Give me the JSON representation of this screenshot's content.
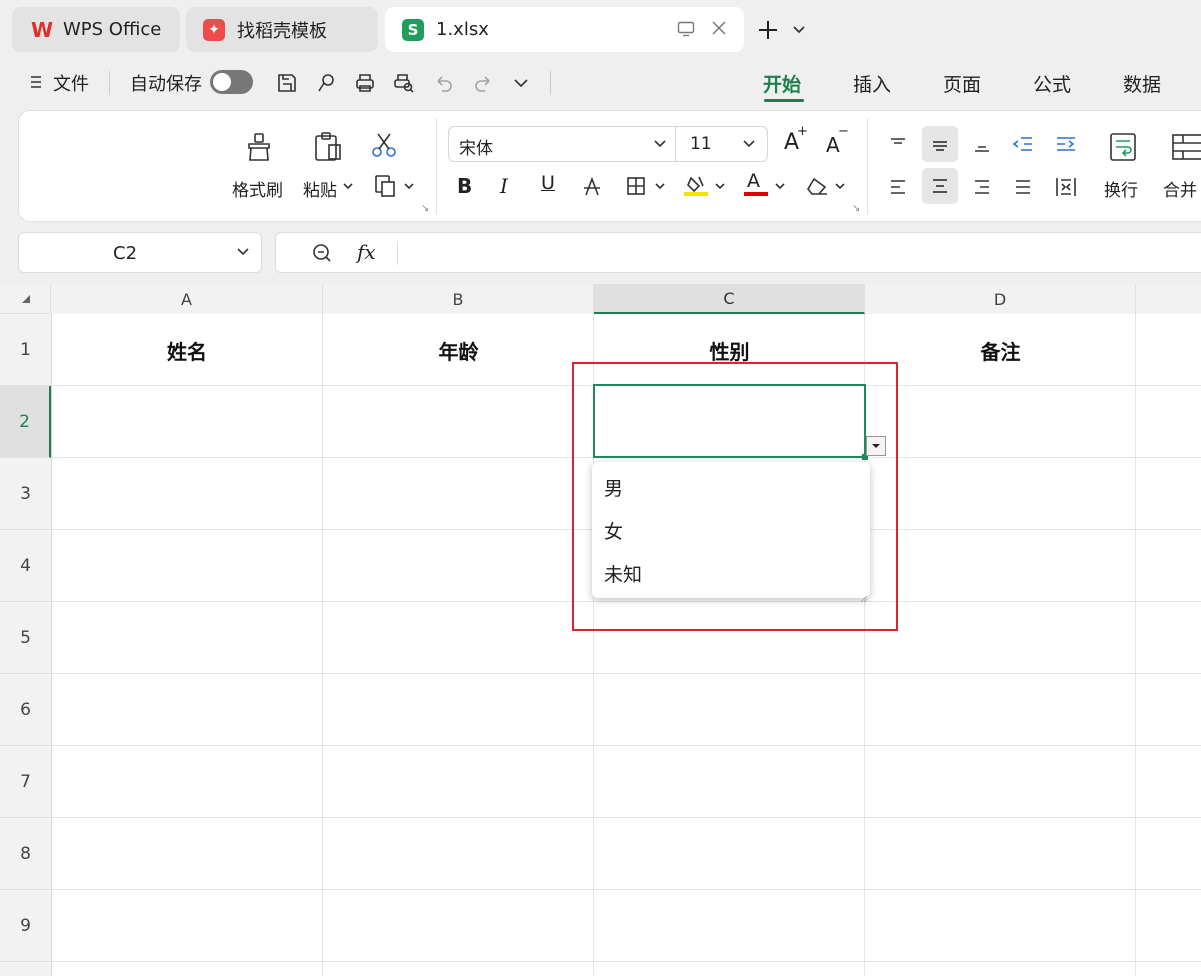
{
  "tabs": [
    {
      "label": "WPS Office",
      "icon": "wps-logo-icon"
    },
    {
      "label": "找稻壳模板",
      "icon": "docer-logo-icon"
    },
    {
      "label": "1.xlsx",
      "icon": "spreadsheet-s-icon",
      "icon_text": "S",
      "active": true
    }
  ],
  "menu": {
    "file_label": "文件",
    "autosave_label": "自动保存",
    "autosave_on": false
  },
  "ribbon_tabs": [
    {
      "label": "开始",
      "active": true
    },
    {
      "label": "插入"
    },
    {
      "label": "页面"
    },
    {
      "label": "公式"
    },
    {
      "label": "数据"
    }
  ],
  "ribbon": {
    "format_painter_label": "格式刷",
    "paste_label": "粘贴",
    "font_name": "宋体",
    "font_size": "11",
    "wrap_label": "换行",
    "merge_label": "合并",
    "bold": "B",
    "italic": "I",
    "underline": "U",
    "grow": "A",
    "shrink": "A",
    "fontcolor": "A"
  },
  "formula_bar": {
    "name_box": "C2",
    "fx": "fx",
    "value": ""
  },
  "columns": [
    "A",
    "B",
    "C",
    "D"
  ],
  "rows": [
    "1",
    "2",
    "3",
    "4",
    "5",
    "6",
    "7",
    "8",
    "9"
  ],
  "headers": [
    "姓名",
    "年龄",
    "性别",
    "备注"
  ],
  "dropdown": {
    "options": [
      "男",
      "女",
      "未知"
    ]
  },
  "colors": {
    "accent": "#1e7e4e",
    "highlight_box": "#d9252c",
    "selection": "#1e8c5a",
    "fill_yellow": "#f5e400",
    "font_red": "#e30000"
  }
}
